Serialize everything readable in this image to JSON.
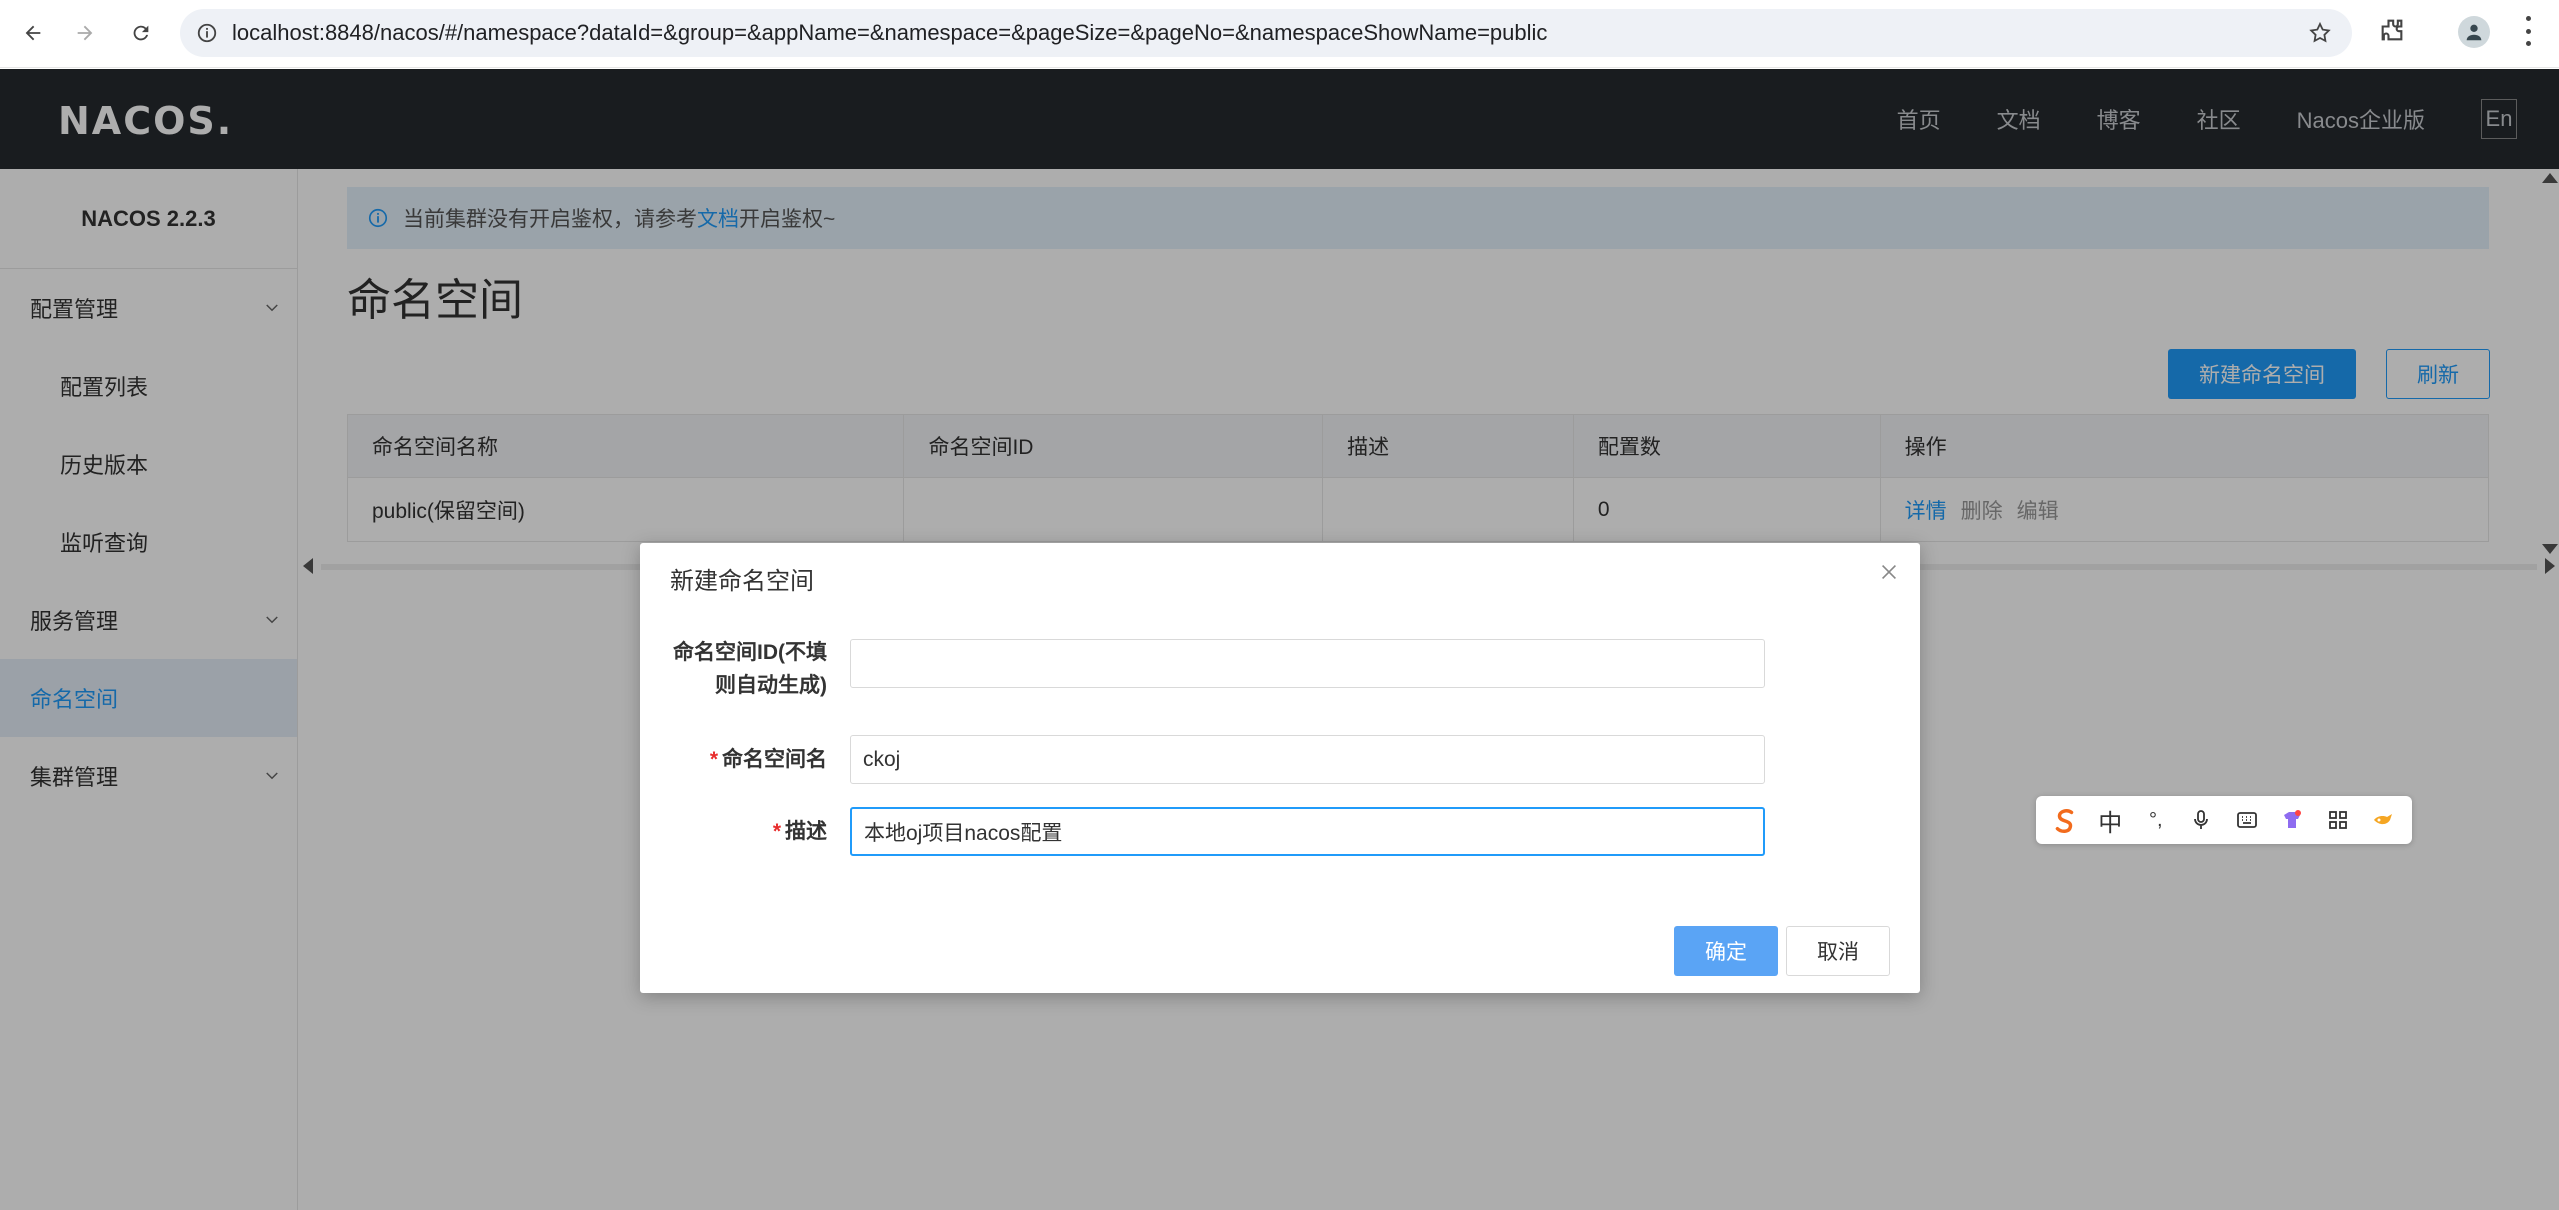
{
  "browser": {
    "url": "localhost:8848/nacos/#/namespace?dataId=&group=&appName=&namespace=&pageSize=&pageNo=&namespaceShowName=public"
  },
  "topnav": {
    "logo": "NACOS.",
    "links": [
      "首页",
      "文档",
      "博客",
      "社区",
      "Nacos企业版"
    ],
    "lang": "En"
  },
  "sidebar": {
    "title": "NACOS 2.2.3",
    "items": [
      {
        "label": "配置管理",
        "type": "group"
      },
      {
        "label": "配置列表",
        "type": "sub"
      },
      {
        "label": "历史版本",
        "type": "sub"
      },
      {
        "label": "监听查询",
        "type": "sub"
      },
      {
        "label": "服务管理",
        "type": "group"
      },
      {
        "label": "命名空间",
        "type": "active"
      },
      {
        "label": "集群管理",
        "type": "group"
      }
    ]
  },
  "main": {
    "notice_prefix": "当前集群没有开启鉴权，请参考",
    "notice_link": "文档",
    "notice_suffix": "开启鉴权~",
    "title": "命名空间",
    "new_button": "新建命名空间",
    "refresh_button": "刷新",
    "table": {
      "headers": [
        "命名空间名称",
        "命名空间ID",
        "描述",
        "配置数",
        "操作"
      ],
      "rows": [
        {
          "name": "public(保留空间)",
          "id": "",
          "desc": "",
          "count": "0",
          "ops": [
            "详情",
            "删除",
            "编辑"
          ]
        }
      ]
    }
  },
  "dialog": {
    "title": "新建命名空间",
    "id_label_line1": "命名空间ID(不填",
    "id_label_line2": "则自动生成)",
    "id_value": "",
    "name_label": "命名空间名",
    "name_value": "ckoj",
    "desc_label": "描述",
    "desc_value": "本地oj项目nacos配置",
    "ok": "确定",
    "cancel": "取消"
  },
  "ime": {
    "items": [
      "sogou-logo-icon",
      "中",
      "°,",
      "mic-icon",
      "keyboard-icon",
      "skin-icon",
      "grid-icon",
      "tools-icon"
    ]
  },
  "colors": {
    "accent": "#209bfa",
    "nav_bg": "#252a2f",
    "required": "#e72b2b"
  }
}
